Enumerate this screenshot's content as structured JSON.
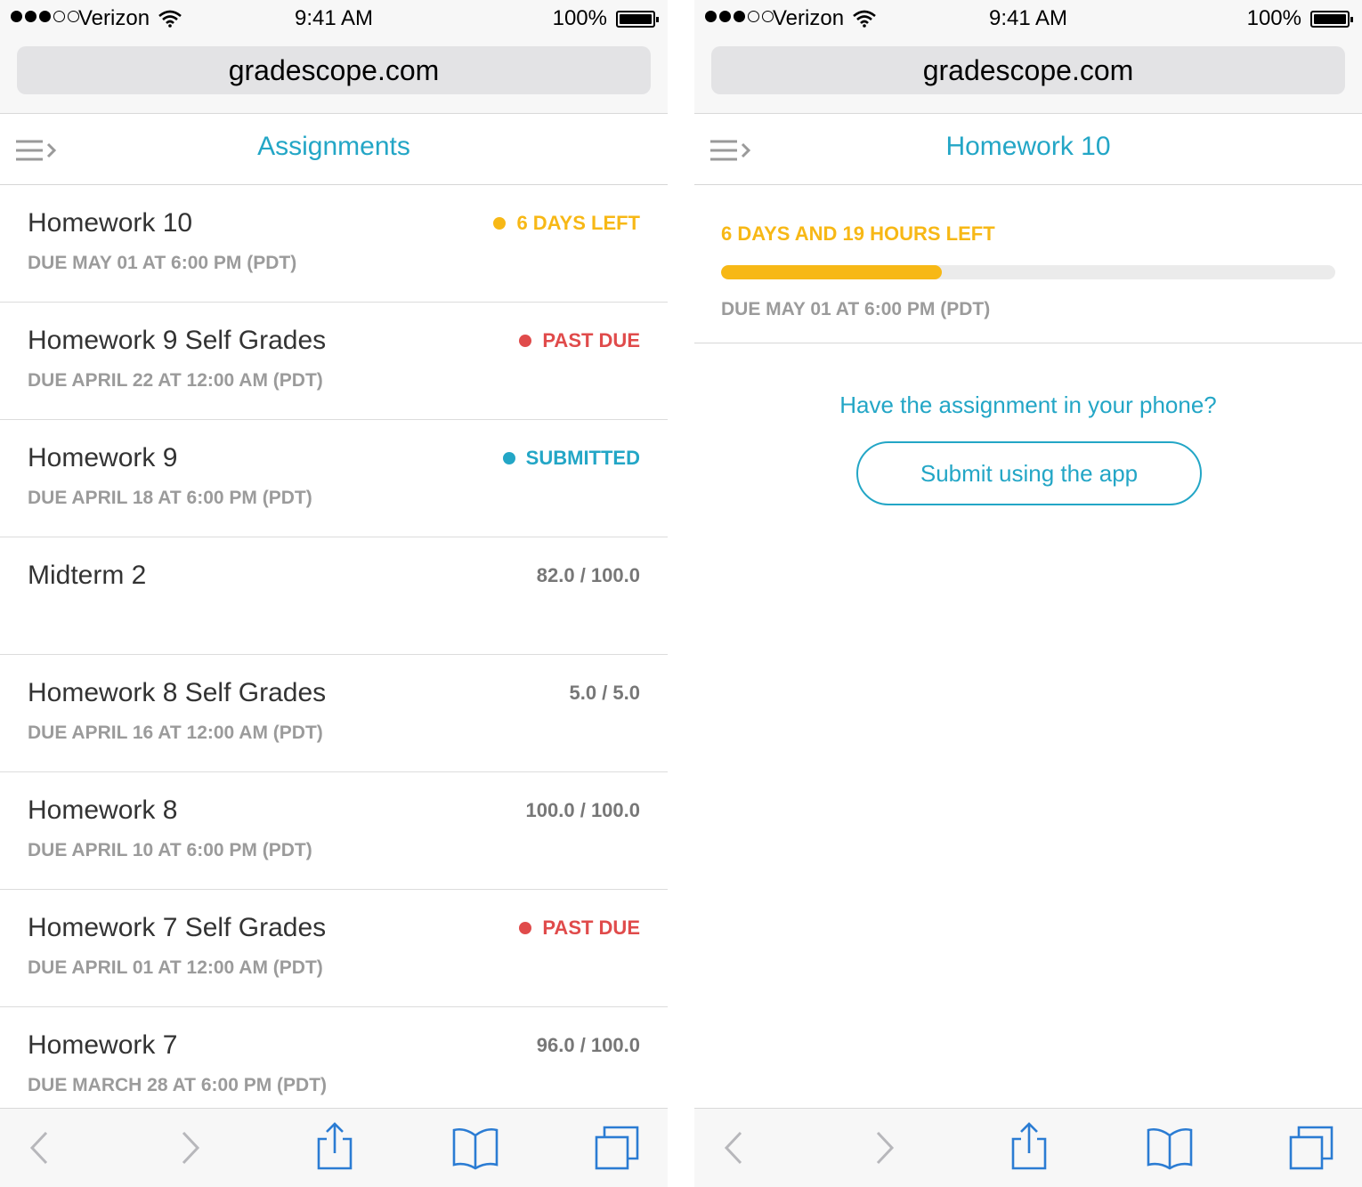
{
  "colors": {
    "accent": "#23a6c6",
    "warning": "#f7b816",
    "danger": "#e04b4b",
    "muted": "#9b9b9b"
  },
  "left": {
    "status": {
      "carrier": "Verizon",
      "time": "9:41 AM",
      "battery": "100%"
    },
    "url": "gradescope.com",
    "header": {
      "title": "Assignments",
      "menu_icon": "menu-icon"
    },
    "assignments": [
      {
        "title": "Homework 10",
        "due": "DUE MAY 01 AT 6:00 PM (PDT)",
        "status": "6 DAYS LEFT",
        "status_color": "#f7b816"
      },
      {
        "title": "Homework 9 Self Grades",
        "due": "DUE APRIL 22 AT 12:00 AM (PDT)",
        "status": "PAST DUE",
        "status_color": "#e04b4b"
      },
      {
        "title": "Homework 9",
        "due": "DUE APRIL 18 AT 6:00 PM (PDT)",
        "status": "SUBMITTED",
        "status_color": "#23a6c6"
      },
      {
        "title": "Midterm 2",
        "due": "",
        "score": "82.0 / 100.0"
      },
      {
        "title": "Homework 8 Self Grades",
        "due": "DUE APRIL 16 AT 12:00 AM (PDT)",
        "score": "5.0 / 5.0"
      },
      {
        "title": "Homework 8",
        "due": "DUE APRIL 10 AT 6:00 PM (PDT)",
        "score": "100.0 / 100.0"
      },
      {
        "title": "Homework 7 Self Grades",
        "due": "DUE APRIL 01 AT 12:00 AM (PDT)",
        "status": "PAST DUE",
        "status_color": "#e04b4b"
      },
      {
        "title": "Homework 7",
        "due": "DUE MARCH 28 AT 6:00 PM (PDT)",
        "score": "96.0 / 100.0"
      }
    ]
  },
  "right": {
    "status": {
      "carrier": "Verizon",
      "time": "9:41 AM",
      "battery": "100%"
    },
    "url": "gradescope.com",
    "header": {
      "title": "Homework 10",
      "menu_icon": "menu-icon"
    },
    "detail": {
      "time_left": "6 DAYS AND 19 HOURS LEFT",
      "progress_fraction": 0.36,
      "due": "DUE MAY 01 AT 6:00 PM (PDT)",
      "prompt": "Have the assignment in your phone?",
      "submit_label": "Submit using the app"
    }
  },
  "toolbar_icons": [
    "back-arrow-icon",
    "forward-arrow-icon",
    "share-icon",
    "bookmarks-icon",
    "tabs-icon"
  ]
}
